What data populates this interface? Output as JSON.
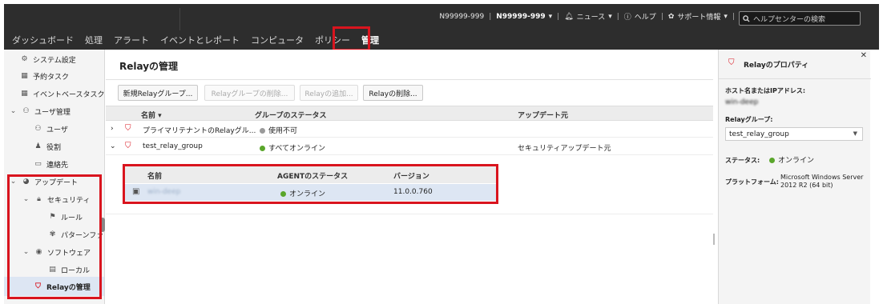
{
  "header": {
    "account_id": "N99999-999",
    "account_menu": "N99999-999",
    "news": "ニュース",
    "help": "ヘルプ",
    "support": "サポート情報",
    "search_placeholder": "ヘルプセンターの検索",
    "nav": [
      "ダッシュボード",
      "処理",
      "アラート",
      "イベントとレポート",
      "コンピュータ",
      "ポリシー",
      "管理"
    ],
    "active_nav": "管理"
  },
  "sidebar": {
    "items": [
      {
        "label": "システム設定",
        "icon": "gear-icon"
      },
      {
        "label": "予約タスク",
        "icon": "calendar-icon"
      },
      {
        "label": "イベントベースタスク",
        "icon": "calendar-icon"
      },
      {
        "label": "ユーザ管理",
        "icon": "users-icon"
      },
      {
        "label": "ユーザ",
        "icon": "users-icon"
      },
      {
        "label": "役割",
        "icon": "role-icon"
      },
      {
        "label": "連絡先",
        "icon": "contact-icon"
      },
      {
        "label": "アップデート",
        "icon": "update-icon"
      },
      {
        "label": "セキュリティ",
        "icon": "lock-icon"
      },
      {
        "label": "ルール",
        "icon": "flag-icon"
      },
      {
        "label": "パターンファ",
        "icon": "pattern-icon"
      },
      {
        "label": "ソフトウェア",
        "icon": "disc-icon"
      },
      {
        "label": "ローカル",
        "icon": "file-icon"
      },
      {
        "label": "Relayの管理",
        "icon": "relay-shield-icon"
      }
    ]
  },
  "main": {
    "title": "Relayの管理",
    "buttons": {
      "new_group": "新規Relayグループ...",
      "delete_group": "Relayグループの削除...",
      "add_relay": "Relayの追加...",
      "delete_relay": "Relayの削除..."
    },
    "columns": {
      "name": "名前 ▾",
      "group_status": "グループのステータス",
      "update_source": "アップデート元"
    },
    "rows": [
      {
        "name": "プライマリテナントのRelayグル...",
        "status": "使用不可",
        "status_color": "#9a9a9a",
        "source": ""
      },
      {
        "name": "test_relay_group",
        "status": "すべてオンライン",
        "status_color": "#5aa62b",
        "source": "セキュリティアップデート元"
      }
    ],
    "sub_table": {
      "columns": {
        "name": "名前",
        "agent_status": "AGENTのステータス",
        "version": "バージョン"
      },
      "row": {
        "name": "win-deep",
        "agent_status": "オンライン",
        "version": "11.0.0.760"
      }
    }
  },
  "properties": {
    "title": "Relayのプロパティ",
    "host_label": "ホスト名またはIPアドレス:",
    "host_value": "win-deep",
    "group_label": "Relayグループ:",
    "group_value": "test_relay_group",
    "status_label": "ステータス:",
    "status_value": "オンライン",
    "platform_label": "プラットフォーム:",
    "platform_line1": "Microsoft Windows Server",
    "platform_line2": "2012 R2 (64 bit)"
  },
  "colors": {
    "highlight": "#d9141e",
    "online": "#5aa62b",
    "unavailable": "#9a9a9a",
    "topbar": "#2d2d2d"
  }
}
